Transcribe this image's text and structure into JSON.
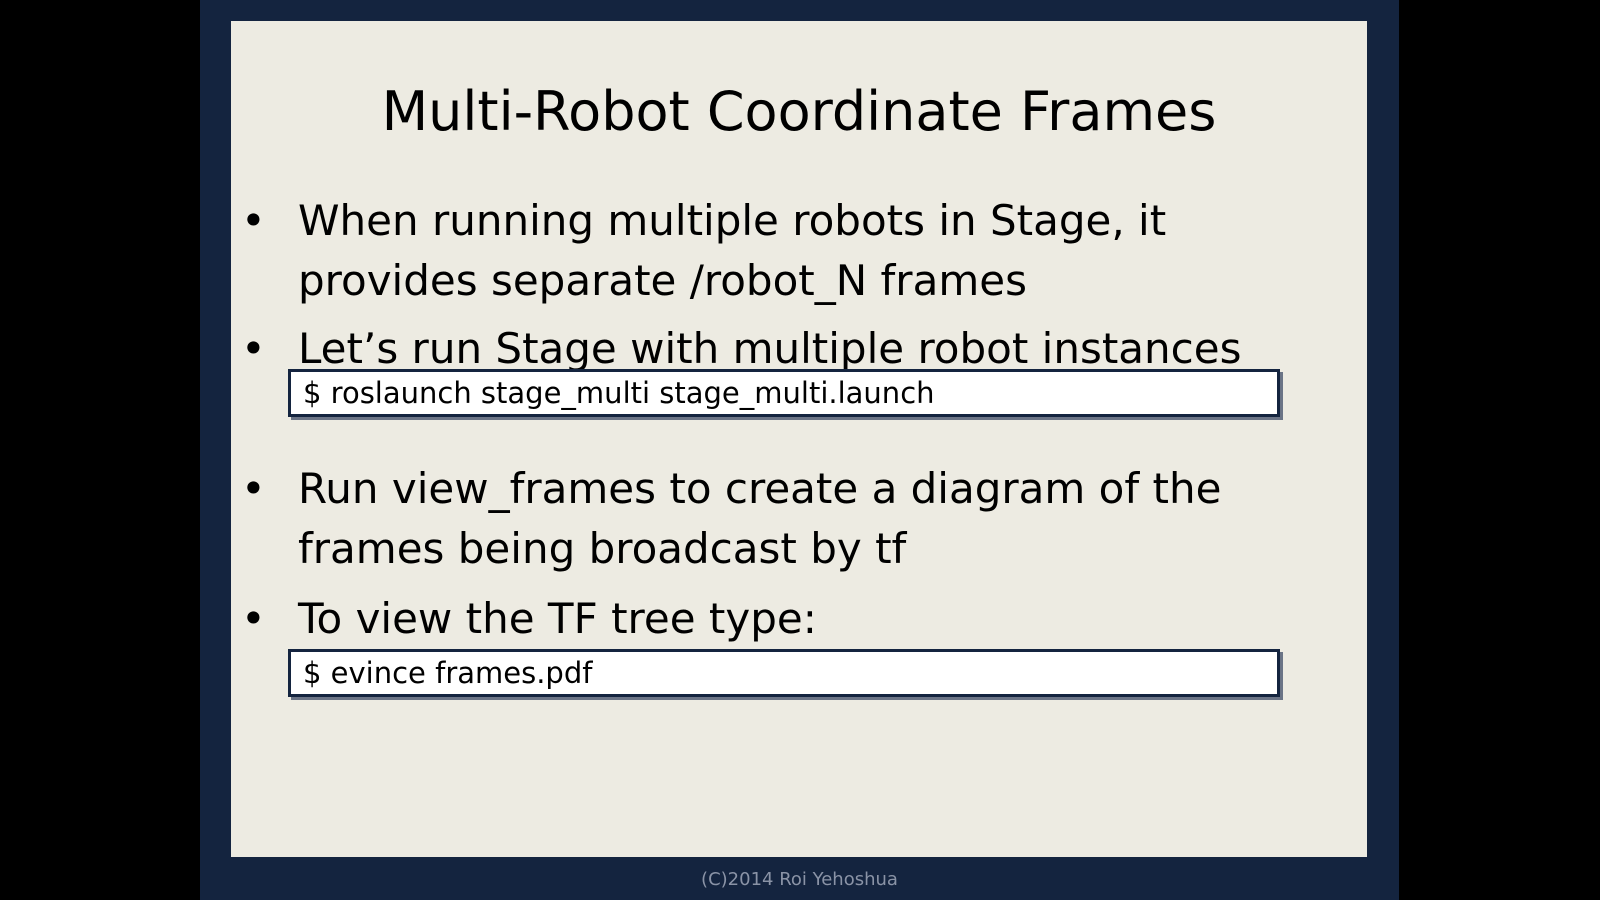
{
  "slide": {
    "title": "Multi-Robot Coordinate Frames",
    "bullet_symbol": "•",
    "bullets": [
      {
        "text": "When running multiple robots in Stage, it provides separate /robot_N frames"
      },
      {
        "text": "Let’s run Stage with multiple robot instances"
      },
      {
        "text": "Run view_frames to create a diagram of the frames being broadcast by tf"
      },
      {
        "text": "To view the TF tree type:"
      }
    ],
    "commands": [
      "$ roslaunch stage_multi stage_multi.launch",
      "$ evince frames.pdf"
    ],
    "footer": "(C)2014 Roi Yehoshua"
  },
  "colors": {
    "slide_background": "#14243f",
    "panel_background": "#edebe2",
    "text": "#000000",
    "command_box_border": "#14243f",
    "footer_text": "#8a93a6"
  }
}
